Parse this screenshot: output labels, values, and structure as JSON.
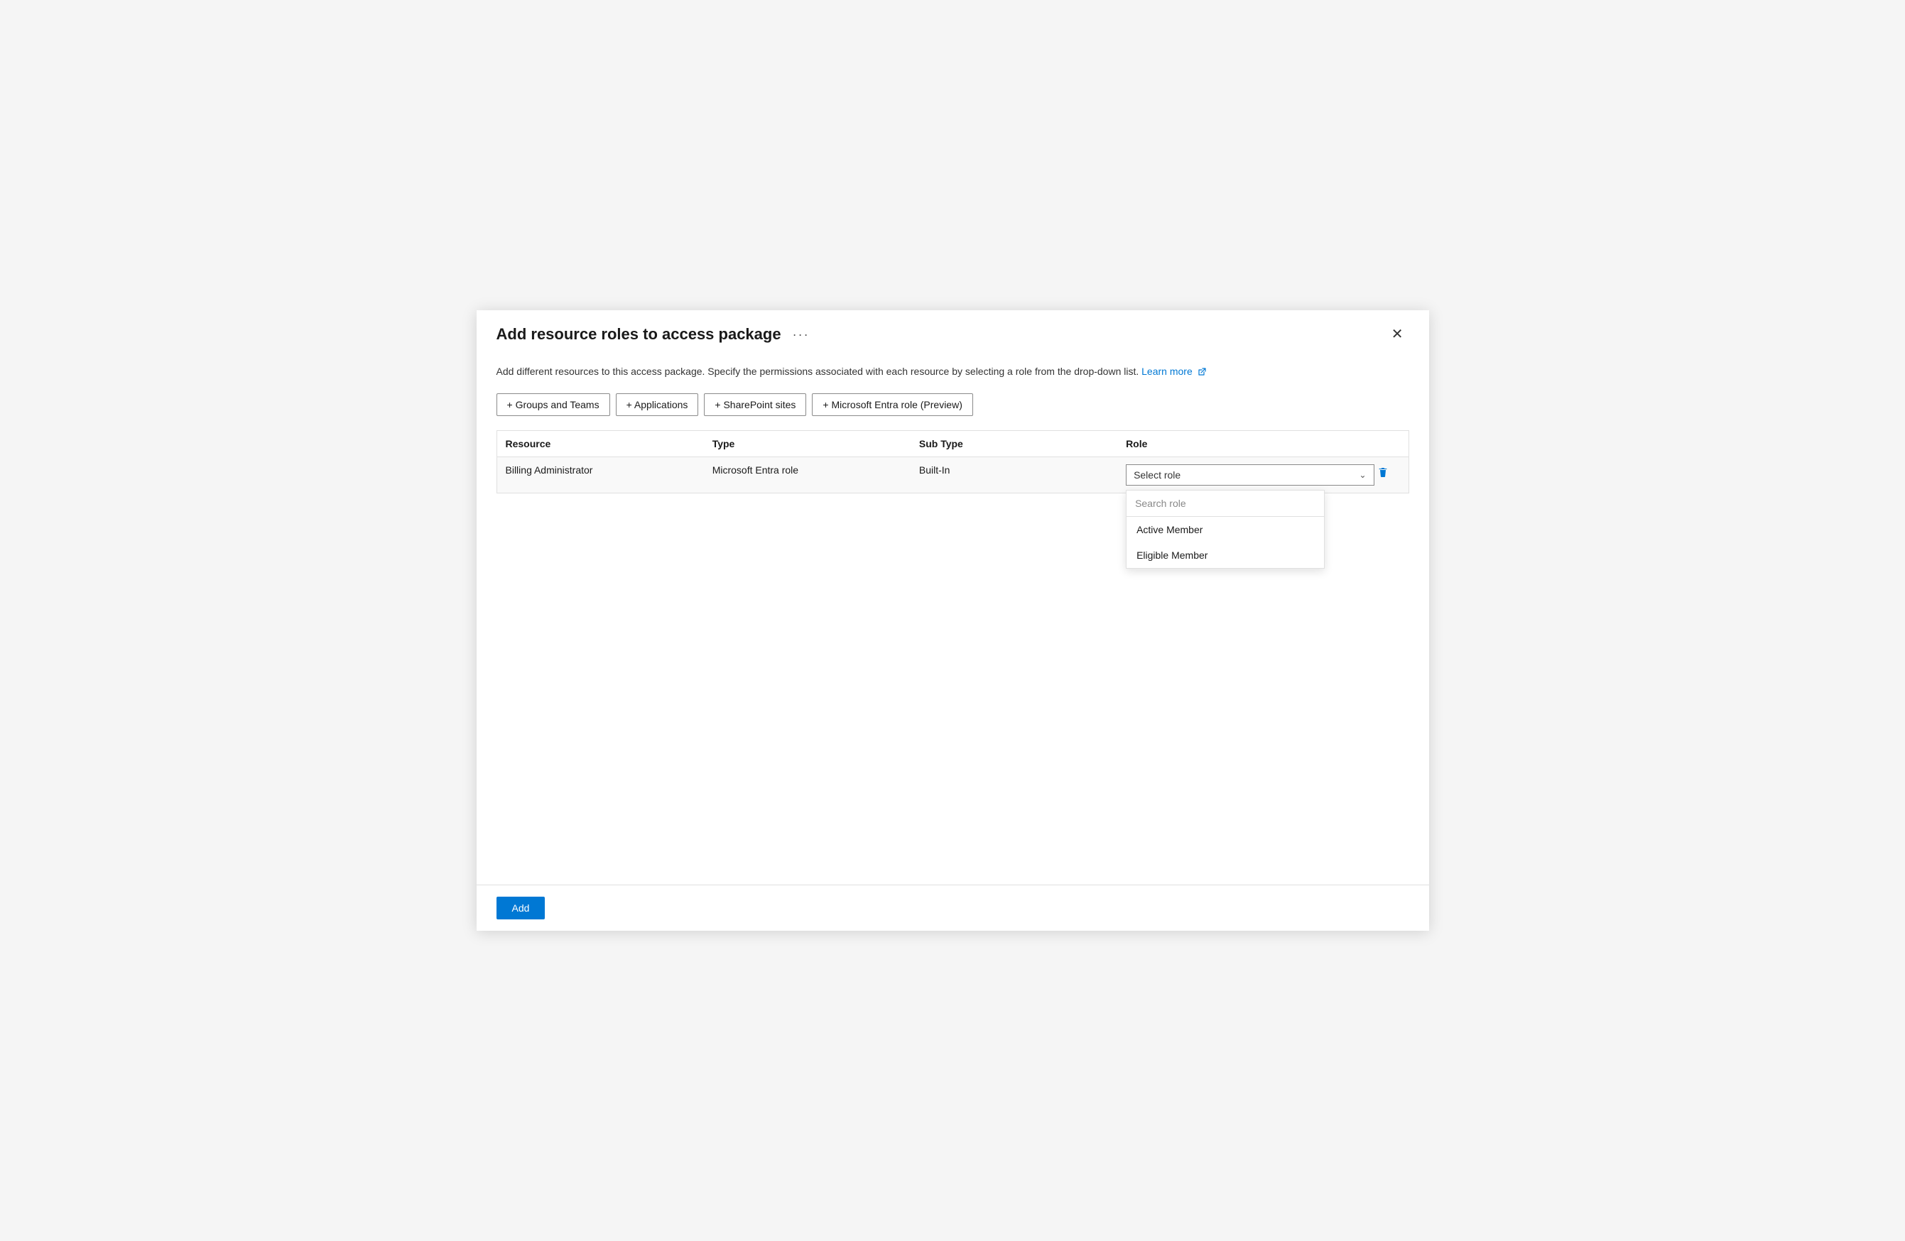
{
  "dialog": {
    "title": "Add resource roles to access package",
    "close_label": "×",
    "ellipsis_label": "...",
    "description_text": "Add different resources to this access package. Specify the permissions associated with each resource by selecting a role from the drop-down list.",
    "learn_more_label": "Learn more",
    "learn_more_url": "#"
  },
  "buttons": {
    "groups_and_teams": "+ Groups and Teams",
    "applications": "+ Applications",
    "sharepoint_sites": "+ SharePoint sites",
    "microsoft_entra_role": "+ Microsoft Entra role (Preview)",
    "add": "Add"
  },
  "table": {
    "headers": {
      "resource": "Resource",
      "type": "Type",
      "sub_type": "Sub Type",
      "role": "Role"
    },
    "rows": [
      {
        "resource": "Billing Administrator",
        "type": "Microsoft Entra role",
        "sub_type": "Built-In",
        "role_placeholder": "Select role"
      }
    ]
  },
  "dropdown": {
    "search_placeholder": "Search role",
    "items": [
      {
        "label": "Active Member"
      },
      {
        "label": "Eligible Member"
      }
    ]
  },
  "icons": {
    "plus": "+",
    "chevron_down": "⌄",
    "trash": "🗑",
    "external_link": "↗",
    "ellipsis": "···",
    "close": "✕"
  }
}
